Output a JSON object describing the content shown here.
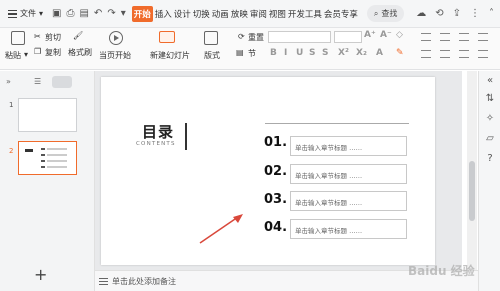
{
  "menubar": {
    "file_label": "文件",
    "tabs": [
      "开始",
      "插入",
      "设计",
      "切换",
      "动画",
      "放映",
      "审阅",
      "视图",
      "开发工具",
      "会员专享"
    ],
    "search_label": "查找"
  },
  "ribbon": {
    "paste": "粘贴",
    "cut": "剪切",
    "copy": "复制",
    "format_painter": "格式刷",
    "from_current": "当页开始",
    "new_slide": "新建幻灯片",
    "layout": "版式",
    "section": "节",
    "reset": "重置"
  },
  "slide": {
    "title": "目录",
    "subtitle": "CONTENTS",
    "items": [
      {
        "num": "01.",
        "text": "单击输入章节标题 ……"
      },
      {
        "num": "02.",
        "text": "单击输入章节标题 ……"
      },
      {
        "num": "03.",
        "text": "单击输入章节标题 ……"
      },
      {
        "num": "04.",
        "text": "单击输入章节标题 ……"
      }
    ]
  },
  "thumbnails": [
    {
      "num": "1"
    },
    {
      "num": "2",
      "selected": true
    }
  ],
  "notes": {
    "placeholder": "单击此处添加备注"
  },
  "watermark": "Baidu 经验",
  "colors": {
    "accent": "#f06b2b",
    "arrow": "#d9483b"
  }
}
